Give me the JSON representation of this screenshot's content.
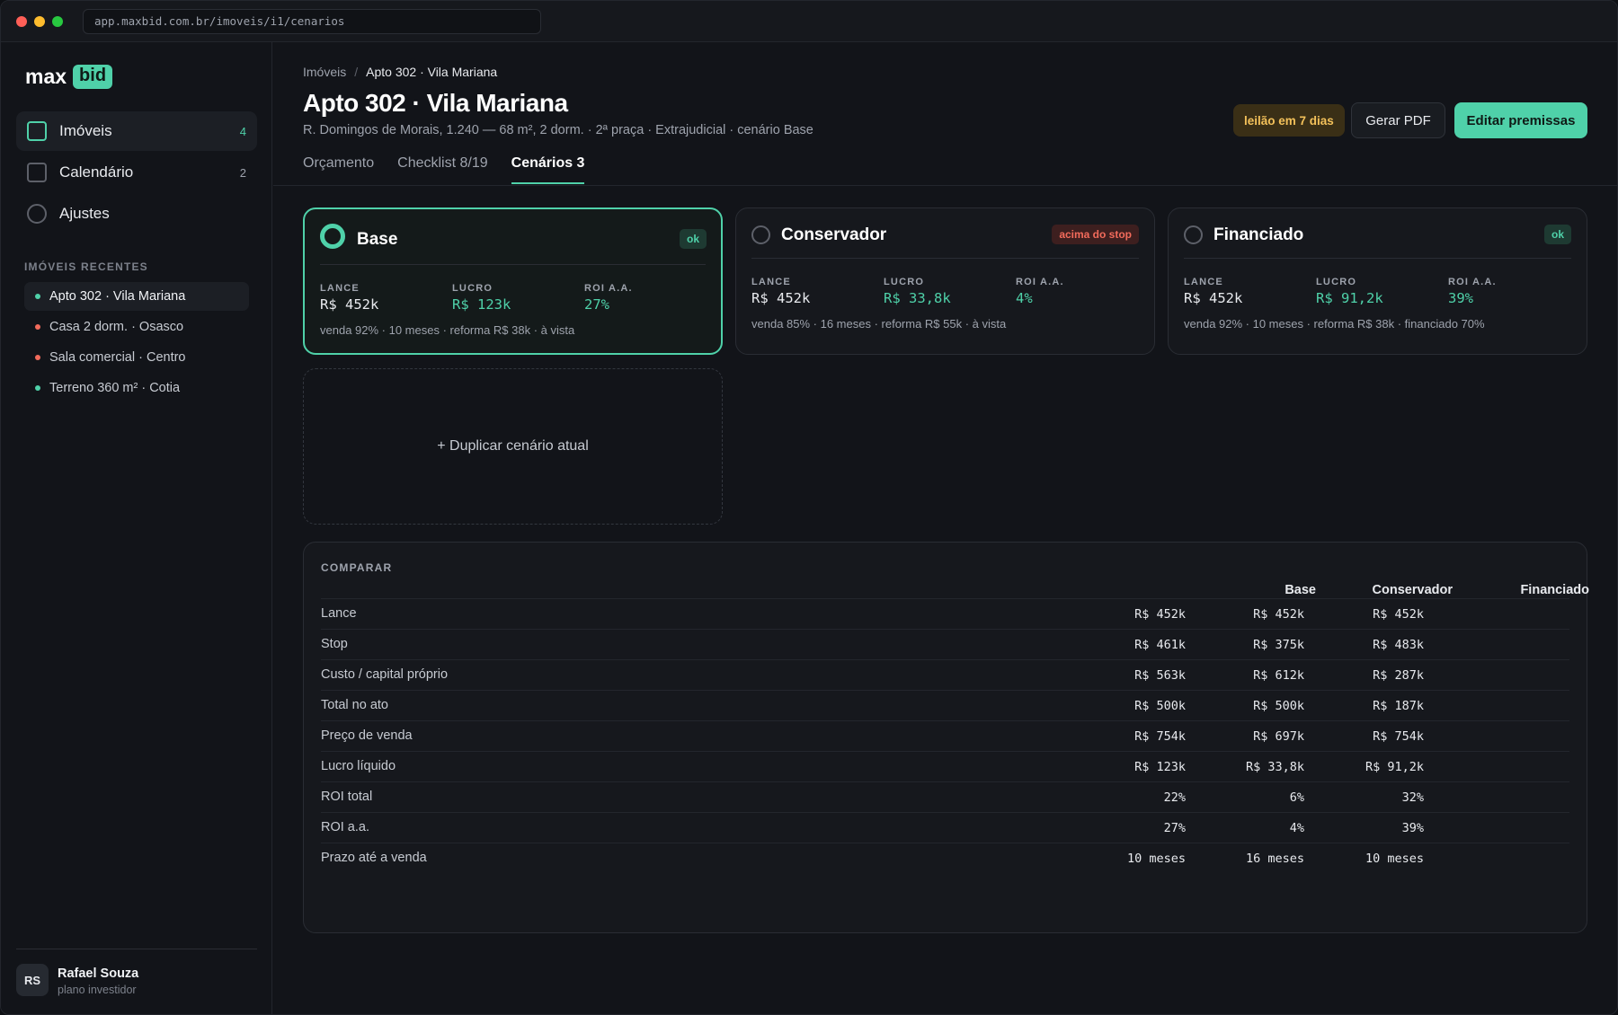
{
  "browser": {
    "url": "app.maxbid.com.br/imoveis/i1/cenarios"
  },
  "logo": {
    "text": "max",
    "badge": "bid"
  },
  "nav": [
    {
      "label": "Imóveis",
      "count": "4"
    },
    {
      "label": "Calendário",
      "count": "2"
    },
    {
      "label": "Ajustes",
      "count": ""
    }
  ],
  "recent": {
    "label": "IMÓVEIS RECENTES",
    "items": [
      {
        "label": "Apto 302 · Vila Mariana",
        "color": "#4fd1a9"
      },
      {
        "label": "Casa 2 dorm. · Osasco",
        "color": "#f26b5b"
      },
      {
        "label": "Sala comercial · Centro",
        "color": "#f26b5b"
      },
      {
        "label": "Terreno 360 m² · Cotia",
        "color": "#4fd1a9"
      }
    ]
  },
  "user": {
    "initials": "RS",
    "name": "Rafael Souza",
    "plan": "plano investidor"
  },
  "breadcrumb": {
    "root": "Imóveis",
    "sep": "/",
    "current": "Apto 302 · Vila Mariana"
  },
  "header": {
    "title": "Apto 302 · Vila Mariana",
    "subtitle": "R. Domingos de Morais, 1.240 — 68 m², 2 dorm. · 2ª praça · Extrajudicial · cenário Base",
    "badge": "leilão em 7 dias",
    "pdf_button": "Gerar PDF",
    "edit_button": "Editar premissas"
  },
  "tabs": [
    "Orçamento",
    "Checklist 8/19",
    "Cenários 3"
  ],
  "metric_labels": {
    "lance": "LANCE",
    "lucro": "LUCRO",
    "roi": "ROI A.A."
  },
  "scenarios": [
    {
      "name": "Base",
      "badge": "ok",
      "lance": "R$ 452k",
      "lucro": "R$ 123k",
      "roi": "27%",
      "desc": "venda 92% · 10 meses · reforma R$ 38k · à vista"
    },
    {
      "name": "Conservador",
      "badge": "acima do stop",
      "lance": "R$ 452k",
      "lucro": "R$ 33,8k",
      "roi": "4%",
      "desc": "venda 85% · 16 meses · reforma R$ 55k · à vista"
    },
    {
      "name": "Financiado",
      "badge": "ok",
      "lance": "R$ 452k",
      "lucro": "R$ 91,2k",
      "roi": "39%",
      "desc": "venda 92% · 10 meses · reforma R$ 38k · financiado 70%"
    }
  ],
  "duplicate_label": "+ Duplicar cenário atual",
  "compare": {
    "title": "COMPARAR",
    "columns": [
      "Base",
      "Conservador",
      "Financiado"
    ],
    "rows": [
      {
        "label": "Lance",
        "values": [
          "R$ 452k",
          "R$ 452k",
          "R$ 452k"
        ]
      },
      {
        "label": "Stop",
        "values": [
          "R$ 461k",
          "R$ 375k",
          "R$ 483k"
        ]
      },
      {
        "label": "Custo / capital próprio",
        "values": [
          "R$ 563k",
          "R$ 612k",
          "R$ 287k"
        ]
      },
      {
        "label": "Total no ato",
        "values": [
          "R$ 500k",
          "R$ 500k",
          "R$ 187k"
        ]
      },
      {
        "label": "Preço de venda",
        "values": [
          "R$ 754k",
          "R$ 697k",
          "R$ 754k"
        ]
      },
      {
        "label": "Lucro líquido",
        "values": [
          "R$ 123k",
          "R$ 33,8k",
          "R$ 91,2k"
        ]
      },
      {
        "label": "ROI total",
        "values": [
          "22%",
          "6%",
          "32%"
        ]
      },
      {
        "label": "ROI a.a.",
        "values": [
          "27%",
          "4%",
          "39%"
        ]
      },
      {
        "label": "Prazo até a venda",
        "values": [
          "10 meses",
          "16 meses",
          "10 meses"
        ]
      }
    ]
  },
  "colors": {
    "accent": "#4fd1a9",
    "danger": "#f26b5b",
    "warning": "#f3c15a"
  }
}
